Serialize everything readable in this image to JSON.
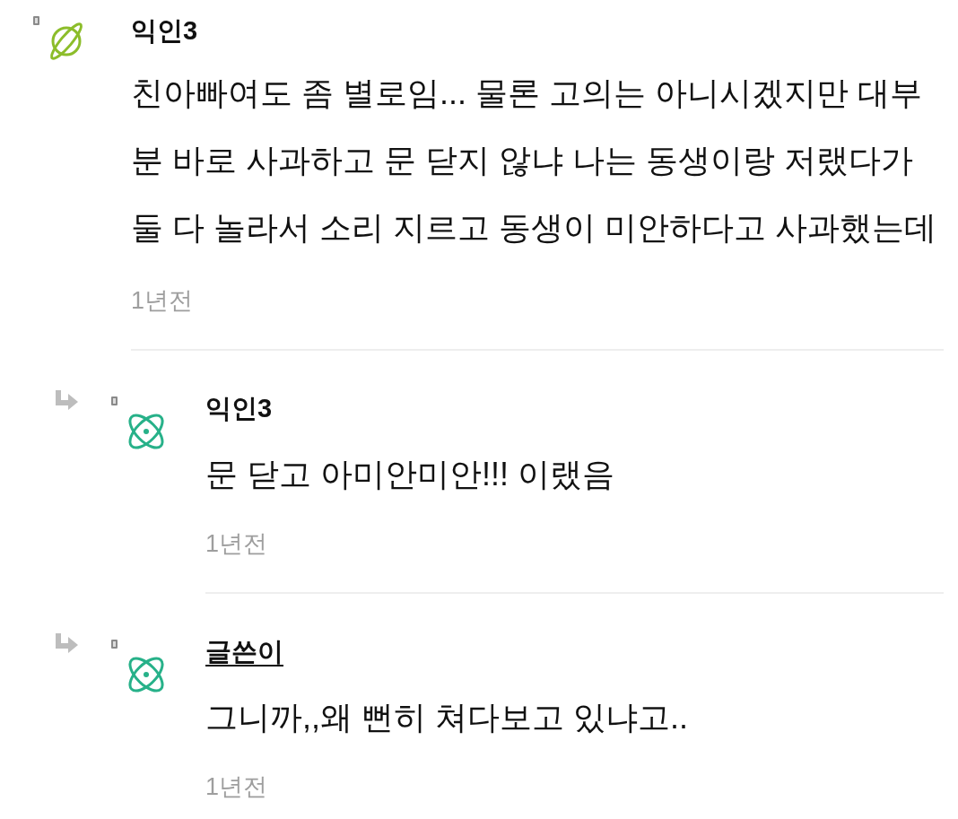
{
  "comments": [
    {
      "author": "익인3",
      "is_op": false,
      "avatar": {
        "kind": "planet"
      },
      "text": "친아빠여도 좀 별로임... 물론 고의는 아니시겠지만 대부분 바로 사과하고 문 닫지 않냐 나는 동생이랑 저랬다가 둘 다 놀라서 소리 지르고 동생이 미안하다고 사과했는데",
      "time": "1년전",
      "replies": [
        {
          "author": "익인3",
          "is_op": false,
          "avatar": {
            "kind": "atom"
          },
          "text": "문 닫고 아미안미안!!! 이랬음",
          "time": "1년전"
        },
        {
          "author": "글쓴이",
          "is_op": true,
          "avatar": {
            "kind": "atom"
          },
          "text": "그니까,,왜 뻔히 쳐다보고 있냐고..",
          "time": "1년전"
        }
      ]
    }
  ]
}
